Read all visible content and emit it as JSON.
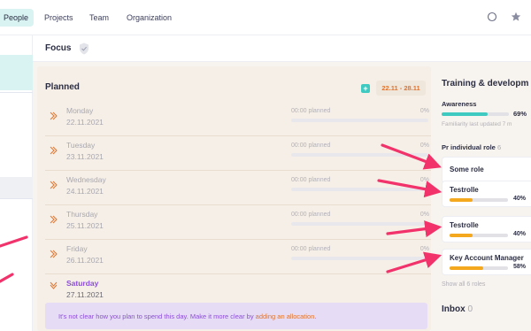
{
  "nav": {
    "items": [
      {
        "label": "People",
        "active": true
      },
      {
        "label": "Projects"
      },
      {
        "label": "Team"
      },
      {
        "label": "Organization"
      }
    ],
    "icons": [
      "search-icon",
      "star-icon"
    ]
  },
  "focus": {
    "title": "Focus",
    "icon": "shield-icon"
  },
  "planned": {
    "title": "Planned",
    "date_range": "22.11 - 28.11",
    "add_icon": "plus-icon",
    "days": [
      {
        "name": "Monday",
        "date": "22.11.2021",
        "planned": "00:00 planned",
        "percent": "0%",
        "progress": 0
      },
      {
        "name": "Tuesday",
        "date": "23.11.2021",
        "planned": "00:00 planned",
        "percent": "0%",
        "progress": 0
      },
      {
        "name": "Wednesday",
        "date": "24.11.2021",
        "planned": "00:00 planned",
        "percent": "0%",
        "progress": 0
      },
      {
        "name": "Thursday",
        "date": "25.11.2021",
        "planned": "00:00 planned",
        "percent": "0%",
        "progress": 0
      },
      {
        "name": "Friday",
        "date": "26.11.2021",
        "planned": "00:00 planned",
        "percent": "0%",
        "progress": 0
      },
      {
        "name": "Saturday",
        "date": "27.11.2021",
        "expanded": true
      }
    ],
    "notice": {
      "text": "It's not clear how you plan to spend this day. Make it more clear by",
      "link": "adding an allocation",
      "suffix": "."
    }
  },
  "training": {
    "title": "Training & developm",
    "awareness": {
      "label": "Awareness",
      "percent": "69%",
      "progress": 0.69,
      "subtext": "Familiarity last updated 7 m"
    },
    "roles_heading": "Pr individual role",
    "roles_count": "6",
    "roles": [
      {
        "name": "Some role"
      },
      {
        "name": "Testrolle",
        "percent": "40%",
        "progress": 0.4
      },
      {
        "name": "Testrolle",
        "percent": "40%",
        "progress": 0.4
      },
      {
        "name": "Key Account Manager",
        "percent": "58%",
        "progress": 0.58
      }
    ],
    "show_all": "Show all 6 roles"
  },
  "inbox": {
    "label": "Inbox",
    "count": "0"
  },
  "colors": {
    "accent_teal": "#3ec9c1",
    "accent_orange": "#e0742f",
    "accent_purple": "#8b4fd6",
    "role_bar": "#f4a81d",
    "annotation_arrow": "#f2336b"
  }
}
